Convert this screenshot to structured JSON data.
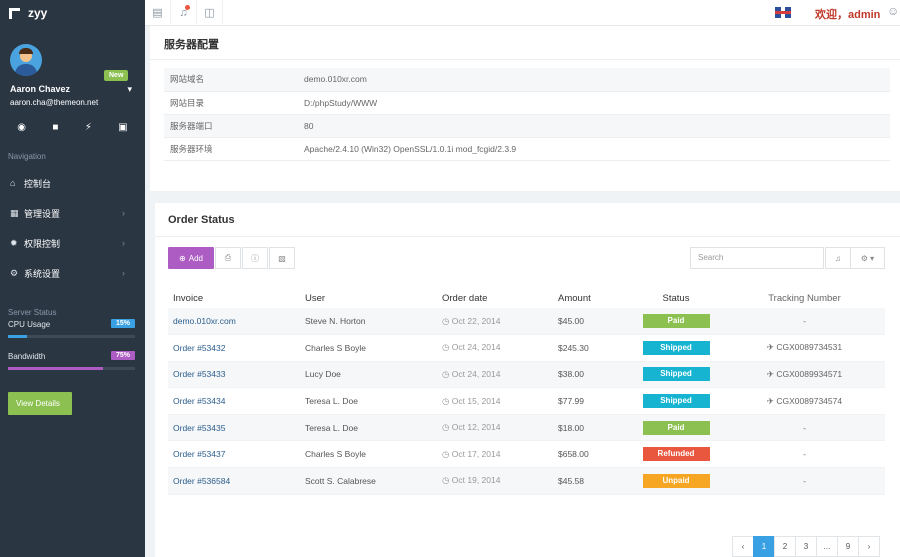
{
  "brand": {
    "name": "zyy"
  },
  "profile": {
    "name": "Aaron Chavez",
    "email": "aaron.cha@themeon.net",
    "badge": "New"
  },
  "quick_icons": [
    "user-icon",
    "chat-icon",
    "bolt-icon",
    "lock-icon"
  ],
  "nav": {
    "title": "Navigation",
    "items": [
      {
        "label": "控制台",
        "icon": "home-icon",
        "chevron": ""
      },
      {
        "label": "管理设置",
        "icon": "grid-icon",
        "chevron": "›"
      },
      {
        "label": "权限控制",
        "icon": "gear-icon",
        "chevron": "›"
      },
      {
        "label": "系统设置",
        "icon": "cog-icon",
        "chevron": "›"
      }
    ]
  },
  "server_status": {
    "title": "Server Status",
    "cpu": {
      "label": "CPU Usage",
      "pct_label": "15%",
      "value": 0.15,
      "color": "#3aa0e4"
    },
    "bandwidth": {
      "label": "Bandwidth",
      "pct_label": "75%",
      "value": 0.75,
      "color": "#ac5cc3"
    },
    "details_button": "View Details"
  },
  "topbar": {
    "welcome": "欢迎，admin"
  },
  "server_config": {
    "title": "服务器配置",
    "rows": [
      {
        "key": "网站域名",
        "value": "demo.010xr.com"
      },
      {
        "key": "网站目录",
        "value": "D:/phpStudy/WWW"
      },
      {
        "key": "服务器端口",
        "value": "80"
      },
      {
        "key": "服务器环境",
        "value": "Apache/2.4.10 (Win32) OpenSSL/1.0.1i mod_fcgid/2.3.9"
      }
    ]
  },
  "orders": {
    "title": "Order Status",
    "add_label": "Add",
    "search_placeholder": "Search",
    "columns": {
      "invoice": "Invoice",
      "user": "User",
      "date": "Order date",
      "amount": "Amount",
      "status": "Status",
      "tracking": "Tracking Number"
    },
    "rows": [
      {
        "invoice": "demo.010xr.com",
        "user": "Steve N. Horton",
        "date": "Oct 22, 2014",
        "amount": "$45.00",
        "status": "Paid",
        "status_color": "#8cc152",
        "tracking": "-"
      },
      {
        "invoice": "Order #53432",
        "user": "Charles S Boyle",
        "date": "Oct 24, 2014",
        "amount": "$245.30",
        "status": "Shipped",
        "status_color": "#17b4d2",
        "tracking": "CGX0089734531"
      },
      {
        "invoice": "Order #53433",
        "user": "Lucy Doe",
        "date": "Oct 24, 2014",
        "amount": "$38.00",
        "status": "Shipped",
        "status_color": "#17b4d2",
        "tracking": "CGX0089934571"
      },
      {
        "invoice": "Order #53434",
        "user": "Teresa L. Doe",
        "date": "Oct 15, 2014",
        "amount": "$77.99",
        "status": "Shipped",
        "status_color": "#17b4d2",
        "tracking": "CGX0089734574"
      },
      {
        "invoice": "Order #53435",
        "user": "Teresa L. Doe",
        "date": "Oct 12, 2014",
        "amount": "$18.00",
        "status": "Paid",
        "status_color": "#8cc152",
        "tracking": "-"
      },
      {
        "invoice": "Order #53437",
        "user": "Charles S Boyle",
        "date": "Oct 17, 2014",
        "amount": "$658.00",
        "status": "Refunded",
        "status_color": "#e9573f",
        "tracking": "-"
      },
      {
        "invoice": "Order #536584",
        "user": "Scott S. Calabrese",
        "date": "Oct 19, 2014",
        "amount": "$45.58",
        "status": "Unpaid",
        "status_color": "#f6a623",
        "tracking": "-"
      }
    ],
    "pagination": [
      "‹",
      "1",
      "2",
      "3",
      "...",
      "9",
      "›"
    ]
  }
}
